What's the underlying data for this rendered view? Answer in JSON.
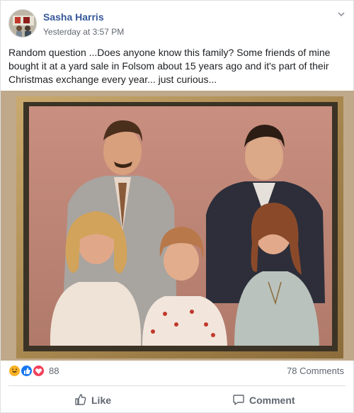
{
  "post": {
    "author": "Sasha Harris",
    "timestamp": "Yesterday at 3:57 PM",
    "text": "Random question ...Does anyone know this family? Some friends of mine bought it at a yard sale in Folsom about 15 years ago and it's part of their Christmas exchange every year... just curious...",
    "more_icon": "chevron-down-icon"
  },
  "photo": {
    "description_icon": "framed-family-photo"
  },
  "reactions": {
    "icons": [
      "haha-icon",
      "like-icon",
      "love-icon"
    ],
    "count": "88",
    "comments": "78 Comments"
  },
  "actions": {
    "like_label": "Like",
    "comment_label": "Comment"
  },
  "colors": {
    "author": "#365899",
    "meta": "#616770",
    "like_blue": "#1877f2",
    "love_red": "#f33e58",
    "haha_yellow": "#f7b125"
  }
}
